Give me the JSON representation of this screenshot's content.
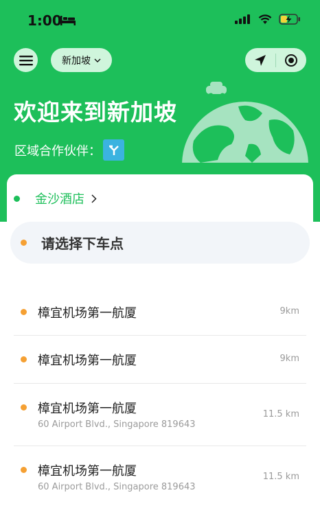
{
  "status_bar": {
    "time": "1:00"
  },
  "header": {
    "city": "新加坡",
    "welcome": "欢迎来到新加坡",
    "partner_label": "区域合作伙伴："
  },
  "pickup": {
    "label": "金沙酒店"
  },
  "dropoff": {
    "placeholder": "请选择下车点"
  },
  "destinations": [
    {
      "name": "樟宜机场第一航厦",
      "address": "",
      "distance": "9km"
    },
    {
      "name": "樟宜机场第一航厦",
      "address": "",
      "distance": "9km"
    },
    {
      "name": "樟宜机场第一航厦",
      "address": "60 Airport Blvd., Singapore 819643",
      "distance": "11.5 km"
    },
    {
      "name": "樟宜机场第一航厦",
      "address": "60 Airport Blvd., Singapore 819643",
      "distance": "11.5 km"
    }
  ],
  "colors": {
    "brand_green": "#1DBF5A",
    "light_green": "#CFF5DC",
    "orange": "#F5A033",
    "partner_blue": "#3BB3E0"
  }
}
